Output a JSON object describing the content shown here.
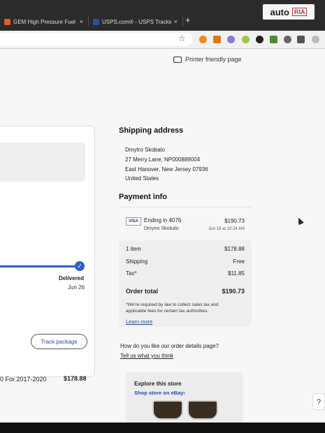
{
  "browser": {
    "tabs": [
      {
        "label": "GEM High Pressure Fuel Pum",
        "favicon_color": "#e25b2b"
      },
      {
        "label": "USPS.com® - USPS Tracking",
        "favicon_color": "#2d4f9e"
      }
    ],
    "close_glyph": "×",
    "new_tab_glyph": "+",
    "watermark": {
      "brand": "auto",
      "badge": "RIA"
    },
    "toolbar_icons": [
      "star-icon",
      "extension-orange-icon",
      "extension-metamask-icon",
      "extension-purple-icon",
      "extension-green-icon",
      "extension-dark-icon",
      "extension-pen-icon",
      "extension-grey-icon",
      "puzzle-icon",
      "profile-icon"
    ]
  },
  "page": {
    "printer_label": "Printer friendly page",
    "left": {
      "delivered_label": "Delivered",
      "delivered_date": "Jun 26",
      "track_button": "Track package",
      "item_title": "0 For 2017-2020",
      "item_price": "$178.88"
    },
    "shipping": {
      "heading": "Shipping address",
      "lines": [
        "Dmytro Skobalo",
        "27 Merry Lane, NP000889004",
        "East Hanover, New Jersey 07936",
        "United States"
      ]
    },
    "payment": {
      "heading": "Payment info",
      "card_brand": "VISA",
      "ending": "Ending in 4076",
      "cardholder": "Dmytro Skobalo",
      "amount": "$190.73",
      "date": "Jun 18 at 10:24 AM"
    },
    "summary": {
      "rows": [
        {
          "label": "1 item",
          "value": "$178.88"
        },
        {
          "label": "Shipping",
          "value": "Free"
        },
        {
          "label": "Tax*",
          "value": "$11.85"
        }
      ],
      "total_label": "Order total",
      "total_value": "$190.73",
      "note": "*We're required by law to collect sales tax and applicable fees for certain tax authorities.",
      "learn_more": "Learn more"
    },
    "feedback": {
      "question": "How do you like our order details page?",
      "link": "Tell us what you think"
    },
    "store": {
      "title": "Explore this store",
      "link": "Shop store on eBay›"
    },
    "help_label": "?"
  },
  "colors": {
    "accent_blue": "#2f5ec9",
    "link_blue": "#2b4ba3"
  }
}
